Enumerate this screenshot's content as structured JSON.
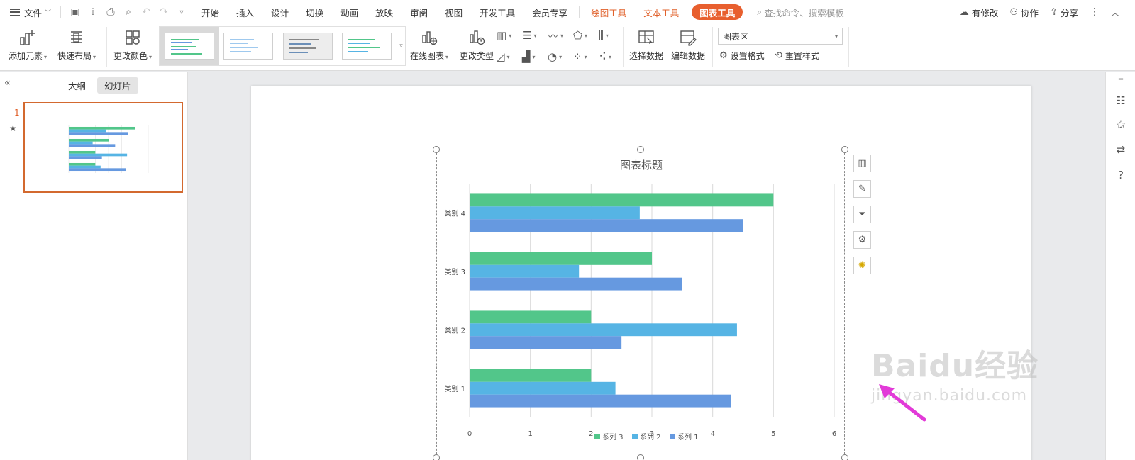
{
  "menubar": {
    "file_label": "文件",
    "tabs": [
      "开始",
      "插入",
      "设计",
      "切换",
      "动画",
      "放映",
      "审阅",
      "视图",
      "开发工具",
      "会员专享"
    ],
    "context_tabs": [
      "绘图工具",
      "文本工具"
    ],
    "active_context_tab": "图表工具",
    "search_placeholder": "查找命令、搜索模板",
    "modified_label": "有修改",
    "collab_label": "协作",
    "share_label": "分享"
  },
  "ribbon": {
    "add_element": "添加元素",
    "quick_layout": "快速布局",
    "change_color": "更改颜色",
    "online_chart": "在线图表",
    "change_type": "更改类型",
    "select_data": "选择数据",
    "edit_data": "编辑数据",
    "chart_area_value": "图表区",
    "set_format": "设置格式",
    "reset_style": "重置样式"
  },
  "left_panel": {
    "tab_outline": "大纲",
    "tab_slides": "幻灯片",
    "slide_number": "1"
  },
  "watermark": {
    "line1": "Baidu经验",
    "line2": "jingyan.baidu.com"
  },
  "colors": {
    "series1": "#6699e0",
    "series2": "#56b4e4",
    "series3": "#52c68a",
    "accent": "#e85f2e"
  },
  "chart_data": {
    "type": "bar",
    "orientation": "horizontal",
    "title": "图表标题",
    "categories": [
      "类别 1",
      "类别 2",
      "类别 3",
      "类别 4"
    ],
    "series": [
      {
        "name": "系列 1",
        "values": [
          4.3,
          2.5,
          3.5,
          4.5
        ]
      },
      {
        "name": "系列 2",
        "values": [
          2.4,
          4.4,
          1.8,
          2.8
        ]
      },
      {
        "name": "系列 3",
        "values": [
          2.0,
          2.0,
          3.0,
          5.0
        ]
      }
    ],
    "xlim": [
      0,
      6
    ],
    "xticks": [
      "0",
      "1",
      "2",
      "3",
      "4",
      "5",
      "6"
    ],
    "grid": true,
    "legend_position": "bottom",
    "legend_order": [
      "系列 3",
      "系列 2",
      "系列 1"
    ]
  }
}
